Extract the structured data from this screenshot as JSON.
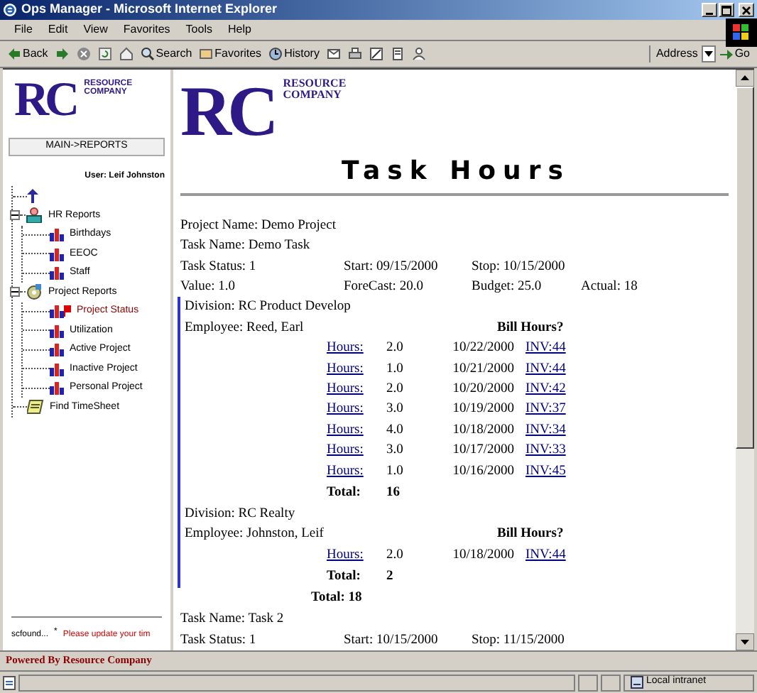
{
  "window": {
    "title": "Ops Manager - Microsoft Internet Explorer"
  },
  "menu": [
    "File",
    "Edit",
    "View",
    "Favorites",
    "Tools",
    "Help"
  ],
  "toolbar": {
    "back": "Back",
    "search": "Search",
    "favorites": "Favorites",
    "history": "History",
    "address_label": "Address",
    "go": "Go"
  },
  "sidebar": {
    "logo": {
      "mark": "RC",
      "line_1": "RESOURCE",
      "line_2": "COMPANY"
    },
    "nav_button": "MAIN->REPORTS",
    "user": "User: Leif Johnston",
    "tree": [
      {
        "label": "HR Reports",
        "kind": "people",
        "expanded": true,
        "selected": false,
        "children": [
          {
            "label": "Birthdays",
            "kind": "chart",
            "selected": false
          },
          {
            "label": "EEOC",
            "kind": "chart",
            "selected": false
          },
          {
            "label": "Staff",
            "kind": "chart",
            "selected": false
          }
        ]
      },
      {
        "label": "Project Reports",
        "kind": "gear",
        "expanded": true,
        "selected": false,
        "children": [
          {
            "label": "Project Status",
            "kind": "chart",
            "selected": true
          },
          {
            "label": "Utilization",
            "kind": "chart",
            "selected": false
          },
          {
            "label": "Active Project",
            "kind": "chart",
            "selected": false
          },
          {
            "label": "Inactive Project",
            "kind": "chart",
            "selected": false
          },
          {
            "label": "Personal Project",
            "kind": "chart",
            "selected": false
          }
        ]
      },
      {
        "label": "Find TimeSheet",
        "kind": "sheet",
        "selected": false
      }
    ],
    "footer": {
      "left": "scfound...",
      "mark": "*",
      "notice": "Please update your tim"
    }
  },
  "main": {
    "logo": {
      "mark": "RC",
      "line_1": "RESOURCE",
      "line_2": "COMPANY"
    },
    "title": "Task Hours",
    "blocks": [
      {
        "kind": "info",
        "rows": [
          [
            "Project Name: Demo Project"
          ],
          [
            "Task Name: Demo Task"
          ],
          [
            "Task Status: 1",
            "Start: 09/15/2000",
            "Stop: 10/15/2000"
          ],
          [
            "Value: 1.0",
            "ForeCast: 20.0",
            "Budget: 25.0",
            "Actual: 18"
          ]
        ]
      },
      {
        "kind": "division",
        "division": "Division: RC Product Develop",
        "employee": "Employee: Reed, Earl",
        "bill_header": "Bill Hours?",
        "total_label": "Total:",
        "total": "16",
        "entries": [
          {
            "link": "Hours:",
            "hours": "2.0",
            "date": "10/22/2000",
            "invoice": "INV:44"
          },
          {
            "link": "Hours:",
            "hours": "1.0",
            "date": "10/21/2000",
            "invoice": "INV:44"
          },
          {
            "link": "Hours:",
            "hours": "2.0",
            "date": "10/20/2000",
            "invoice": "INV:42"
          },
          {
            "link": "Hours:",
            "hours": "3.0",
            "date": "10/19/2000",
            "invoice": "INV:37"
          },
          {
            "link": "Hours:",
            "hours": "4.0",
            "date": "10/18/2000",
            "invoice": "INV:34"
          },
          {
            "link": "Hours:",
            "hours": "3.0",
            "date": "10/17/2000",
            "invoice": "INV:33"
          },
          {
            "link": "Hours:",
            "hours": "1.0",
            "date": "10/16/2000",
            "invoice": "INV:45"
          }
        ]
      },
      {
        "kind": "division",
        "division": "Division: RC Realty",
        "employee": "Employee: Johnston, Leif",
        "bill_header": "Bill Hours?",
        "total_label": "Total:",
        "total": "2",
        "entries": [
          {
            "link": "Hours:",
            "hours": "2.0",
            "date": "10/18/2000",
            "invoice": "INV:44"
          }
        ]
      },
      {
        "kind": "grand_total",
        "text": "Total: 18"
      },
      {
        "kind": "info",
        "rows": [
          [
            "Task Name: Task 2"
          ],
          [
            "Task Status: 1",
            "Start: 10/15/2000",
            "Stop: 11/15/2000"
          ]
        ]
      }
    ]
  },
  "powered_by": "Powered By Resource Company",
  "status_bar": {
    "zone": "Local intranet"
  }
}
